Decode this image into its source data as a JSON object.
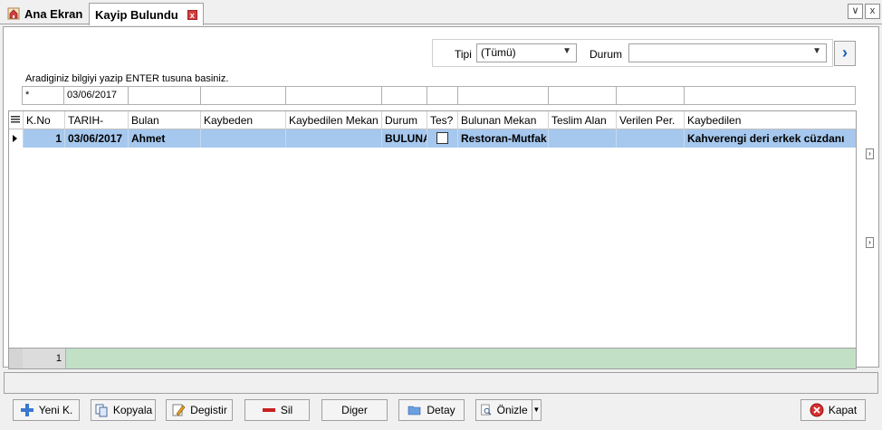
{
  "tabs": {
    "home_label": "Ana Ekran",
    "active_label": "Kayip Bulundu",
    "close_glyph": "x",
    "menu_glyph": "∨",
    "window_close_glyph": "x"
  },
  "filters": {
    "tipi_label": "Tipi",
    "tipi_value": "(Tümü)",
    "durum_label": "Durum",
    "durum_value": "",
    "go_glyph": "›"
  },
  "hint": "Aradiginiz bilgiyi yazip ENTER tusuna basiniz.",
  "search_row": [
    "*",
    "03/06/2017",
    "",
    "",
    "",
    "",
    "",
    "",
    "",
    "",
    ""
  ],
  "grid": {
    "headers": [
      "K.No",
      "TARIH-",
      "Bulan",
      "Kaybeden",
      "Kaybedilen Mekan",
      "Durum",
      "Tes?",
      "Bulunan Mekan",
      "Teslim Alan",
      "Verilen Per.",
      "Kaybedilen"
    ],
    "rows": [
      {
        "kno": "1",
        "tarih": "03/06/2017",
        "bulan": "Ahmet",
        "kaybeden": "",
        "kaybedilen_mekan": "",
        "durum": "BULUNA",
        "tes": false,
        "bulunan_mekan": "Restoran-Mutfak",
        "teslim_alan": "",
        "verilen_per": "",
        "kaybedilen": "Kahverengi deri erkek cüzdanı"
      }
    ],
    "footer_count": "1"
  },
  "buttons": {
    "yeni": "Yeni K.",
    "kopyala": "Kopyala",
    "degistir": "Degistir",
    "sil": "Sil",
    "diger": "Diger",
    "detay": "Detay",
    "onizle": "Önizle",
    "kapat": "Kapat"
  },
  "colors": {
    "selected_row": "#a6c8ee",
    "footer_band": "#c2e0c6",
    "accent": "#1a5fb4"
  }
}
